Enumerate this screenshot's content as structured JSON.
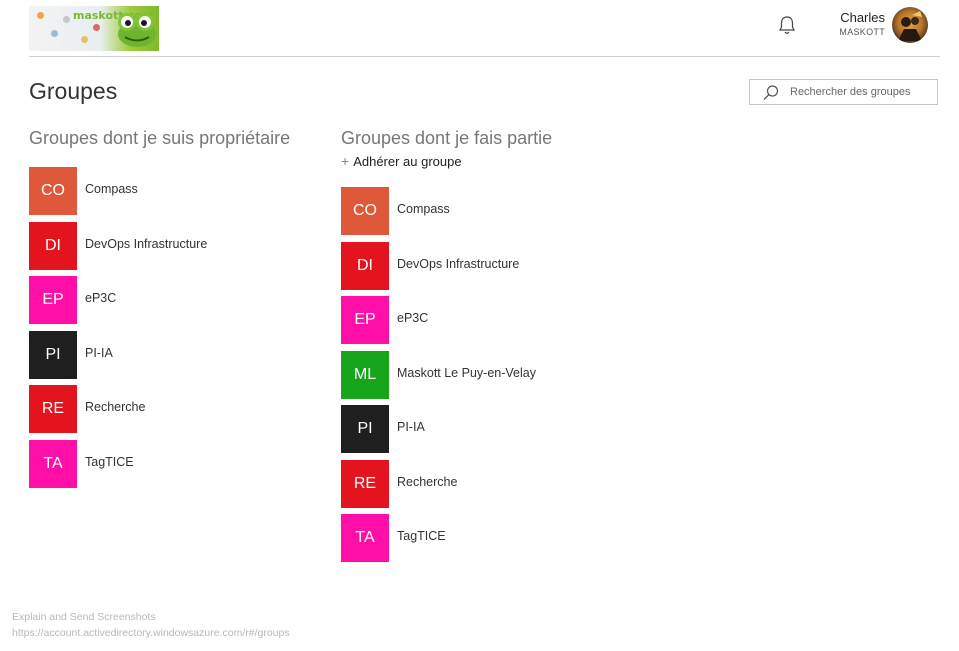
{
  "header": {
    "logo_text": "maskott.com",
    "user_name": "Charles",
    "user_org": "MASKOTT",
    "icons": {
      "notifications": "bell-icon",
      "search": "search-icon"
    }
  },
  "page": {
    "title": "Groupes"
  },
  "search": {
    "placeholder": "Rechercher des groupes",
    "value": ""
  },
  "owned": {
    "title": "Groupes dont je suis propriétaire",
    "groups": [
      {
        "initials": "CO",
        "name": "Compass",
        "color": "#e0583a"
      },
      {
        "initials": "DI",
        "name": "DevOps Infrastructure",
        "color": "#e3141d"
      },
      {
        "initials": "EP",
        "name": "eP3C",
        "color": "#ff0fa8"
      },
      {
        "initials": "PI",
        "name": "PI-IA",
        "color": "#1f1f1f"
      },
      {
        "initials": "RE",
        "name": "Recherche",
        "color": "#e3141d"
      },
      {
        "initials": "TA",
        "name": "TagTICE",
        "color": "#ff0fa8"
      }
    ]
  },
  "member": {
    "title": "Groupes dont je fais partie",
    "join_label": "Adhérer au groupe",
    "groups": [
      {
        "initials": "CO",
        "name": "Compass",
        "color": "#e0583a"
      },
      {
        "initials": "DI",
        "name": "DevOps Infrastructure",
        "color": "#e3141d"
      },
      {
        "initials": "EP",
        "name": "eP3C",
        "color": "#ff0fa8"
      },
      {
        "initials": "ML",
        "name": "Maskott Le Puy-en-Velay",
        "color": "#17a51c"
      },
      {
        "initials": "PI",
        "name": "PI-IA",
        "color": "#1f1f1f"
      },
      {
        "initials": "RE",
        "name": "Recherche",
        "color": "#e3141d"
      },
      {
        "initials": "TA",
        "name": "TagTICE",
        "color": "#ff0fa8"
      }
    ]
  },
  "footer": {
    "line1": "Explain and Send Screenshots",
    "line2": "https://account.activedirectory.windowsazure.com/r#/groups"
  }
}
